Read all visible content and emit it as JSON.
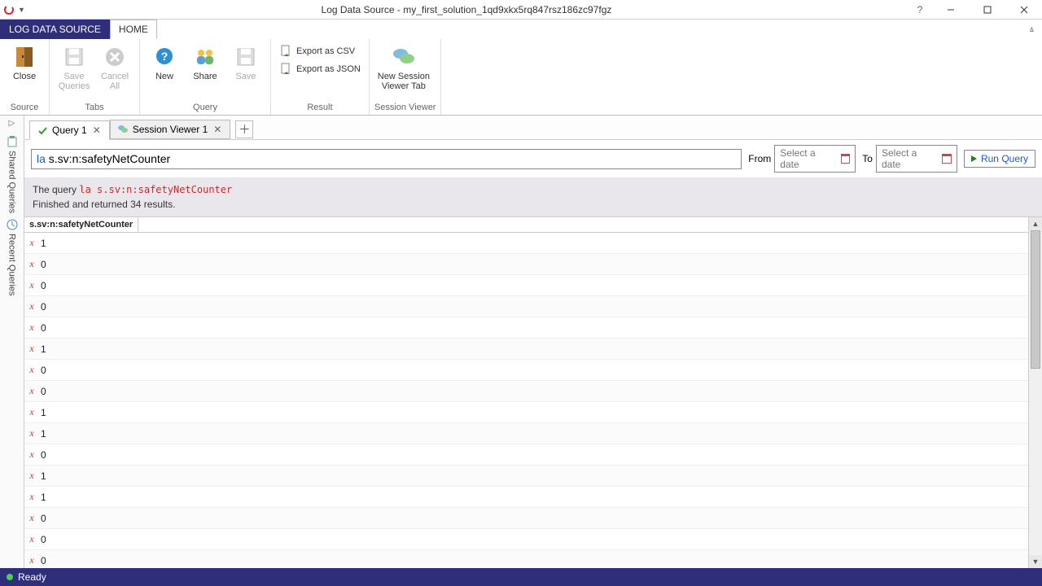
{
  "window": {
    "title": "Log Data Source - my_first_solution_1qd9xkx5rq847rsz186zc97fgz"
  },
  "ribbon_tabs": {
    "context": "LOG DATA SOURCE",
    "home": "HOME"
  },
  "ribbon": {
    "source": {
      "close": "Close",
      "label": "Source"
    },
    "tabs_grp": {
      "save_queries": "Save\nQueries",
      "cancel_all": "Cancel\nAll",
      "label": "Tabs"
    },
    "query_grp": {
      "new": "New",
      "share": "Share",
      "save": "Save",
      "label": "Query"
    },
    "result_grp": {
      "export_csv": "Export as CSV",
      "export_json": "Export as JSON",
      "label": "Result"
    },
    "session_grp": {
      "new_session": "New Session\nViewer Tab",
      "label": "Session Viewer"
    }
  },
  "side": {
    "shared": "Shared Queries",
    "recent": "Recent Queries"
  },
  "doctabs": {
    "query1": "Query 1",
    "session1": "Session Viewer 1"
  },
  "querybar": {
    "query_kw": "la",
    "query_rest": " s.sv:n:safetyNetCounter",
    "from": "From",
    "to": "To",
    "date_placeholder": "Select a date",
    "run": "Run Query"
  },
  "message": {
    "prefix": "The query ",
    "query": "la s.sv:n:safetyNetCounter",
    "line2": "Finished and returned 34 results."
  },
  "table": {
    "col1": "s.sv:n:safetyNetCounter",
    "rows": [
      "1",
      "0",
      "0",
      "0",
      "0",
      "1",
      "0",
      "0",
      "1",
      "1",
      "0",
      "1",
      "1",
      "0",
      "0",
      "0"
    ]
  },
  "status": {
    "text": "Ready"
  }
}
